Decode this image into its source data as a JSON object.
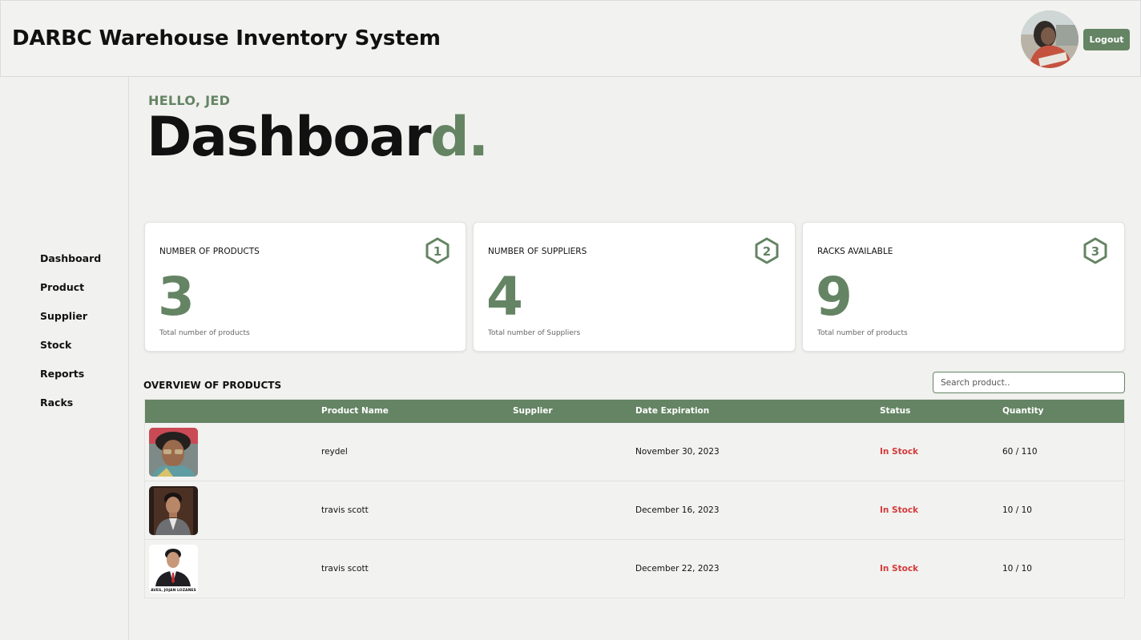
{
  "header": {
    "app_title": "DARBC Warehouse Inventory System",
    "logout_label": "Logout"
  },
  "sidebar": {
    "items": [
      {
        "label": "Dashboard"
      },
      {
        "label": "Product"
      },
      {
        "label": "Supplier"
      },
      {
        "label": "Stock"
      },
      {
        "label": "Reports"
      },
      {
        "label": "Racks"
      }
    ]
  },
  "greeting": {
    "hello": "HELLO, JED",
    "title_main": "Dashboar",
    "title_accent": "d."
  },
  "cards": [
    {
      "label": "NUMBER OF PRODUCTS",
      "value": "3",
      "caption": "Total number of products",
      "icon": "hexagon-1-icon",
      "badge": "1"
    },
    {
      "label": "NUMBER OF SUPPLIERS",
      "value": "4",
      "caption": "Total number of Suppliers",
      "icon": "hexagon-2-icon",
      "badge": "2"
    },
    {
      "label": "RACKS AVAILABLE",
      "value": "9",
      "caption": "Total number of products",
      "icon": "hexagon-3-icon",
      "badge": "3"
    }
  ],
  "overview": {
    "title": "OVERVIEW OF PRODUCTS",
    "search_placeholder": "Search product..",
    "columns": [
      "Product Name",
      "Supplier",
      "Date Expiration",
      "Status",
      "Quantity"
    ],
    "rows": [
      {
        "product_name": "reydel",
        "supplier": "",
        "date_expiration": "November 30, 2023",
        "status": "In Stock",
        "quantity": "60 / 110"
      },
      {
        "product_name": "travis scott",
        "supplier": "",
        "date_expiration": "December 16, 2023",
        "status": "In Stock",
        "quantity": "10 / 10"
      },
      {
        "product_name": "travis scott",
        "supplier": "",
        "date_expiration": "December 22, 2023",
        "status": "In Stock",
        "quantity": "10 / 10",
        "thumb_caption": "AVES, JOJAN LOZAÑES"
      }
    ]
  },
  "colors": {
    "accent": "#648463",
    "status_in_stock": "#d33a3a",
    "background": "#f1f1ef"
  }
}
